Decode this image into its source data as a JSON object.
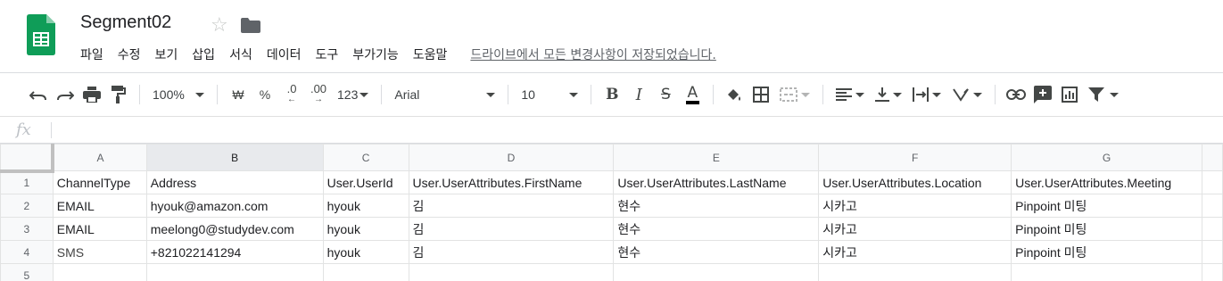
{
  "document": {
    "title": "Segment02",
    "save_status": "드라이브에서 모든 변경사항이 저장되었습니다."
  },
  "menu": [
    "파일",
    "수정",
    "보기",
    "삽입",
    "서식",
    "데이터",
    "도구",
    "부가기능",
    "도움말"
  ],
  "toolbar": {
    "zoom": "100%",
    "currency": "₩",
    "percent": "%",
    "decimal_decrease": ".0",
    "decimal_increase": ".00",
    "more_formats": "123",
    "font": "Arial",
    "font_size": "10",
    "bold": "B",
    "italic": "I",
    "strikethrough": "S",
    "text_color": "A"
  },
  "formula_bar": {
    "label": "fx",
    "value": ""
  },
  "columns": [
    "A",
    "B",
    "C",
    "D",
    "E",
    "F",
    "G"
  ],
  "rows": [
    {
      "num": "1",
      "cells": [
        "ChannelType",
        "Address",
        "User.UserId",
        "User.UserAttributes.FirstName",
        "User.UserAttributes.LastName",
        "User.UserAttributes.Location",
        "User.UserAttributes.Meeting"
      ]
    },
    {
      "num": "2",
      "cells": [
        "EMAIL",
        "hyouk@amazon.com",
        "hyouk",
        "김",
        "현수",
        "시카고",
        "Pinpoint 미팅"
      ]
    },
    {
      "num": "3",
      "cells": [
        "EMAIL",
        "meelong0@studydev.com",
        "hyouk",
        "김",
        "현수",
        "시카고",
        "Pinpoint 미팅"
      ]
    },
    {
      "num": "4",
      "cells": [
        "SMS",
        "+821022141294",
        "hyouk",
        "김",
        "현수",
        "시카고",
        "Pinpoint 미팅"
      ]
    },
    {
      "num": "5",
      "cells": [
        "",
        "",
        "",
        "",
        "",
        "",
        ""
      ]
    }
  ],
  "colors": {
    "sheets_green": "#0f9d58",
    "header_bg": "#f8f9fa",
    "grid_line": "#e2e3e3"
  }
}
